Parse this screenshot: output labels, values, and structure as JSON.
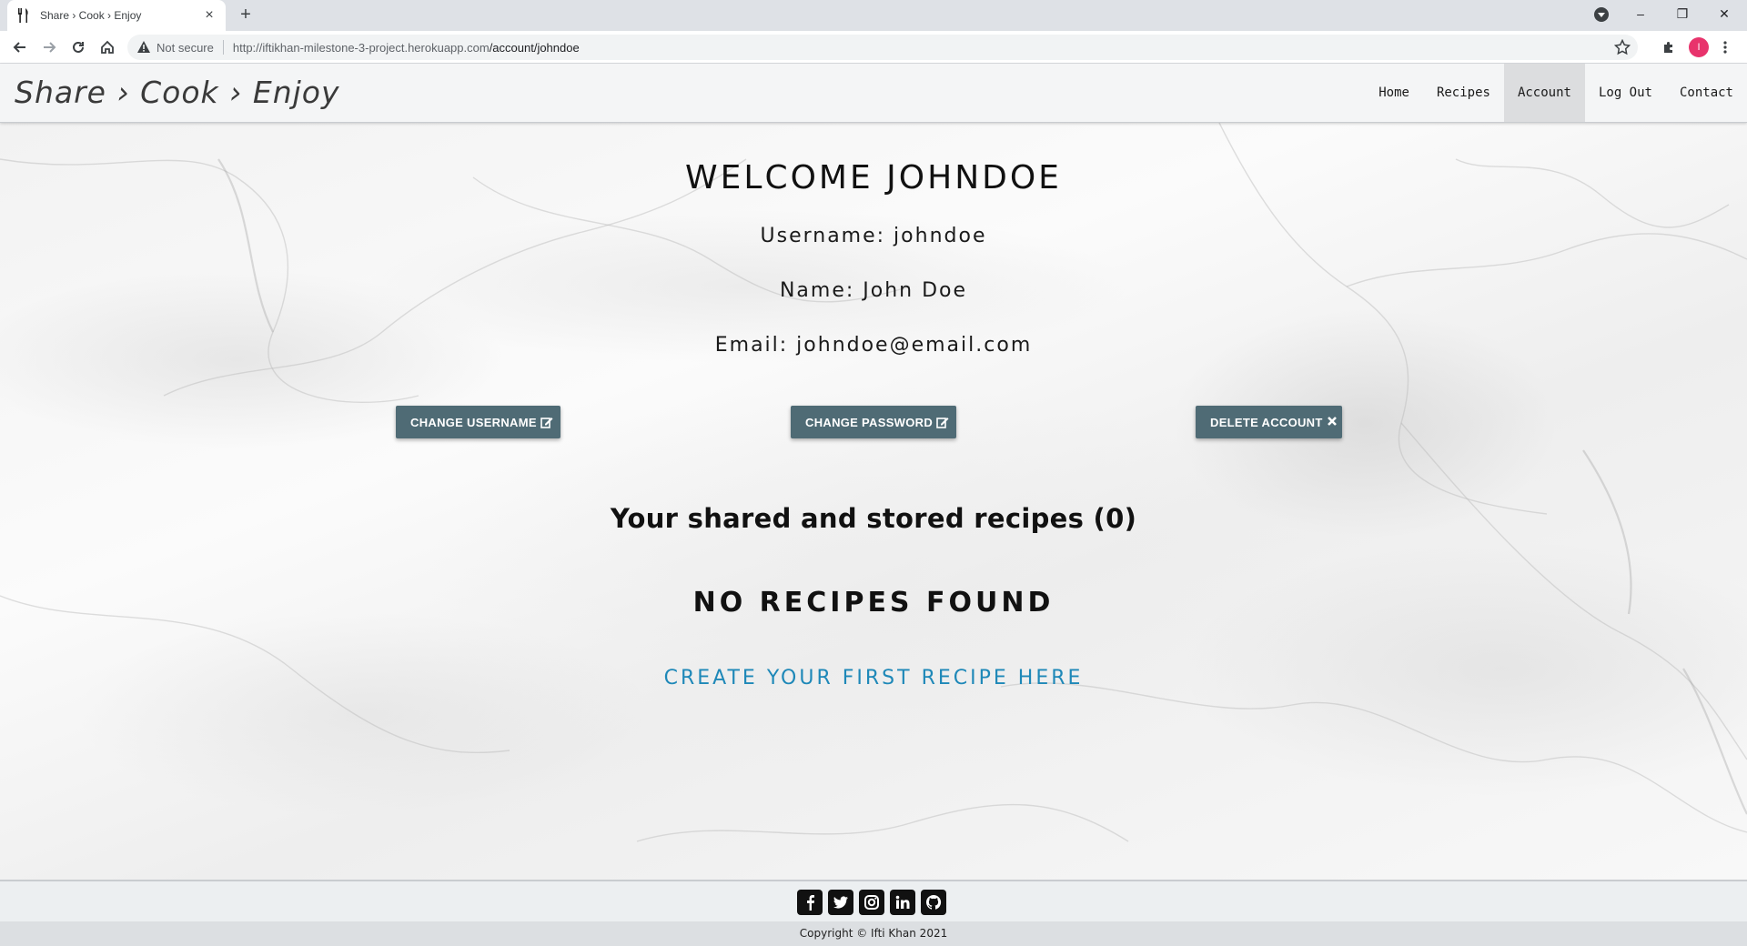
{
  "browser": {
    "tab_title": "Share › Cook › Enjoy",
    "tab_close": "×",
    "new_tab": "+",
    "security_label": "Not secure",
    "url_host": "http://iftikhan-milestone-3-project.herokuapp.com",
    "url_path": "/account/johndoe",
    "profile_initial": "I",
    "window_controls": {
      "minimize": "–",
      "restore": "❐",
      "close": "✕"
    }
  },
  "site": {
    "brand": "Share › Cook › Enjoy",
    "nav": [
      {
        "label": "Home",
        "active": false
      },
      {
        "label": "Recipes",
        "active": false
      },
      {
        "label": "Account",
        "active": true
      },
      {
        "label": "Log Out",
        "active": false
      },
      {
        "label": "Contact",
        "active": false
      }
    ]
  },
  "account": {
    "welcome": "WELCOME JOHNDOE",
    "username_line": "Username: johndoe",
    "name_line": "Name: John Doe",
    "email_line": "Email: johndoe@email.com",
    "buttons": {
      "change_username": "CHANGE USERNAME",
      "change_password": "CHANGE PASSWORD",
      "delete_account": "DELETE ACCOUNT"
    },
    "recipes_heading": "Your shared and stored recipes (0)",
    "no_recipes": "NO RECIPES FOUND",
    "create_link": "CREATE YOUR FIRST RECIPE HERE"
  },
  "footer": {
    "social_icons": [
      "facebook-icon",
      "twitter-icon",
      "instagram-icon",
      "linkedin-icon",
      "github-icon"
    ],
    "copyright": "Copyright © Ifti Khan 2021"
  },
  "colors": {
    "button_bg": "#4f6b75",
    "link": "#1e88b8",
    "nav_active": "#dcdddf",
    "avatar": "#e8336c"
  }
}
